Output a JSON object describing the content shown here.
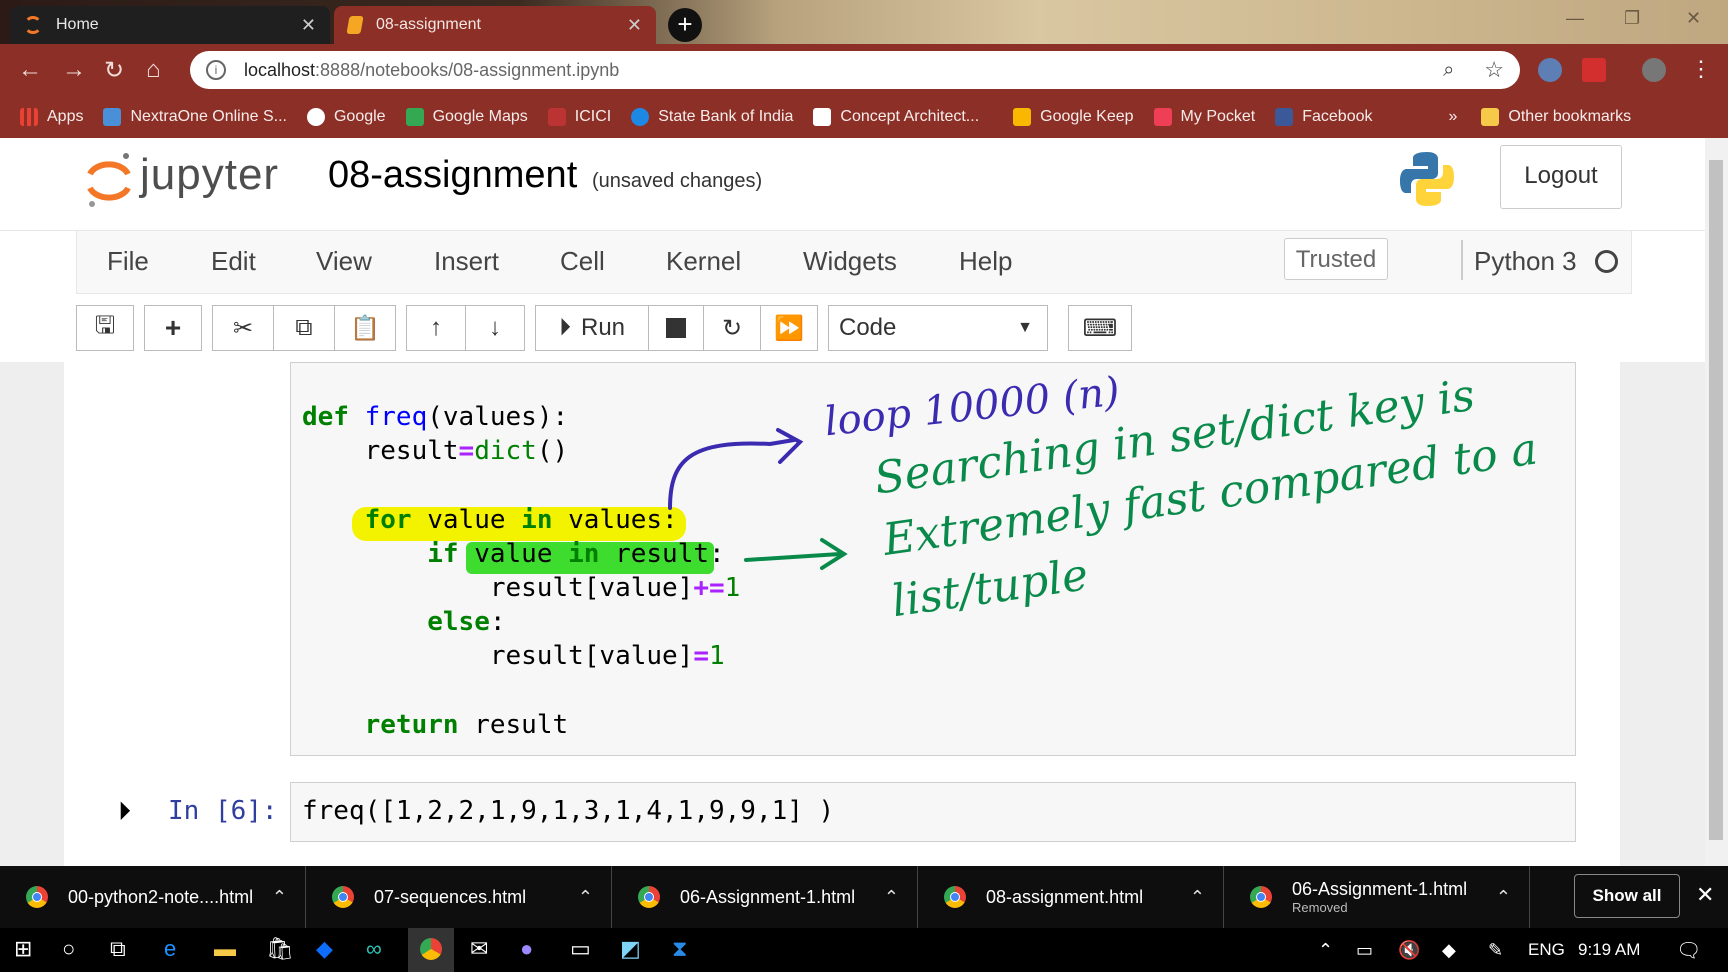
{
  "browser": {
    "tabs": [
      {
        "title": "Home"
      },
      {
        "title": "08-assignment"
      }
    ],
    "url_host": "localhost",
    "url_rest": ":8888/notebooks/08-assignment.ipynb",
    "bookmarks": [
      {
        "label": "Apps",
        "color": "#e94235"
      },
      {
        "label": "NextraOne Online S...",
        "color": "#4a90d9"
      },
      {
        "label": "Google",
        "color": "#ffffff"
      },
      {
        "label": "Google Maps",
        "color": "#34a853"
      },
      {
        "label": "ICICI",
        "color": "#ffffff"
      },
      {
        "label": "State Bank of India",
        "color": "#1e88e5"
      },
      {
        "label": "Concept Architect...",
        "color": "#ffffff"
      },
      {
        "label": "Google Keep",
        "color": "#f9b700"
      },
      {
        "label": "My Pocket",
        "color": "#ef3f56"
      },
      {
        "label": "Facebook",
        "color": "#3b5998"
      }
    ],
    "more_bookmarks": "»",
    "other_bookmarks": "Other bookmarks"
  },
  "jupyter": {
    "logo_text": "jupyter",
    "notebook_title": "08-assignment",
    "status": "(unsaved changes)",
    "logout": "Logout",
    "menu": [
      "File",
      "Edit",
      "View",
      "Insert",
      "Cell",
      "Kernel",
      "Widgets",
      "Help"
    ],
    "trusted": "Trusted",
    "kernel": "Python 3",
    "run_label": "Run",
    "cell_type": "Code"
  },
  "cells": {
    "prompt": "In [6]:",
    "input_code": "freq([1,2,2,1,9,1,3,1,4,1,9,9,1] )"
  },
  "annotations": {
    "note1": "loop 10000 (n)",
    "note2": "Searching in set/dict key is Extremely fast compared to a list/tuple",
    "ink_blue": "#3b2bb0",
    "ink_green": "#0a8a4a",
    "highlight_yellow": "#f3f300",
    "highlight_green": "#3ddc2f"
  },
  "downloads": [
    {
      "name": "00-python2-note....html"
    },
    {
      "name": "07-sequences.html"
    },
    {
      "name": "06-Assignment-1.html"
    },
    {
      "name": "08-assignment.html"
    },
    {
      "name": "06-Assignment-1.html",
      "status": "Removed"
    }
  ],
  "download_bar": {
    "show_all": "Show all"
  },
  "taskbar": {
    "language": "ENG",
    "time": "9:19 AM"
  }
}
